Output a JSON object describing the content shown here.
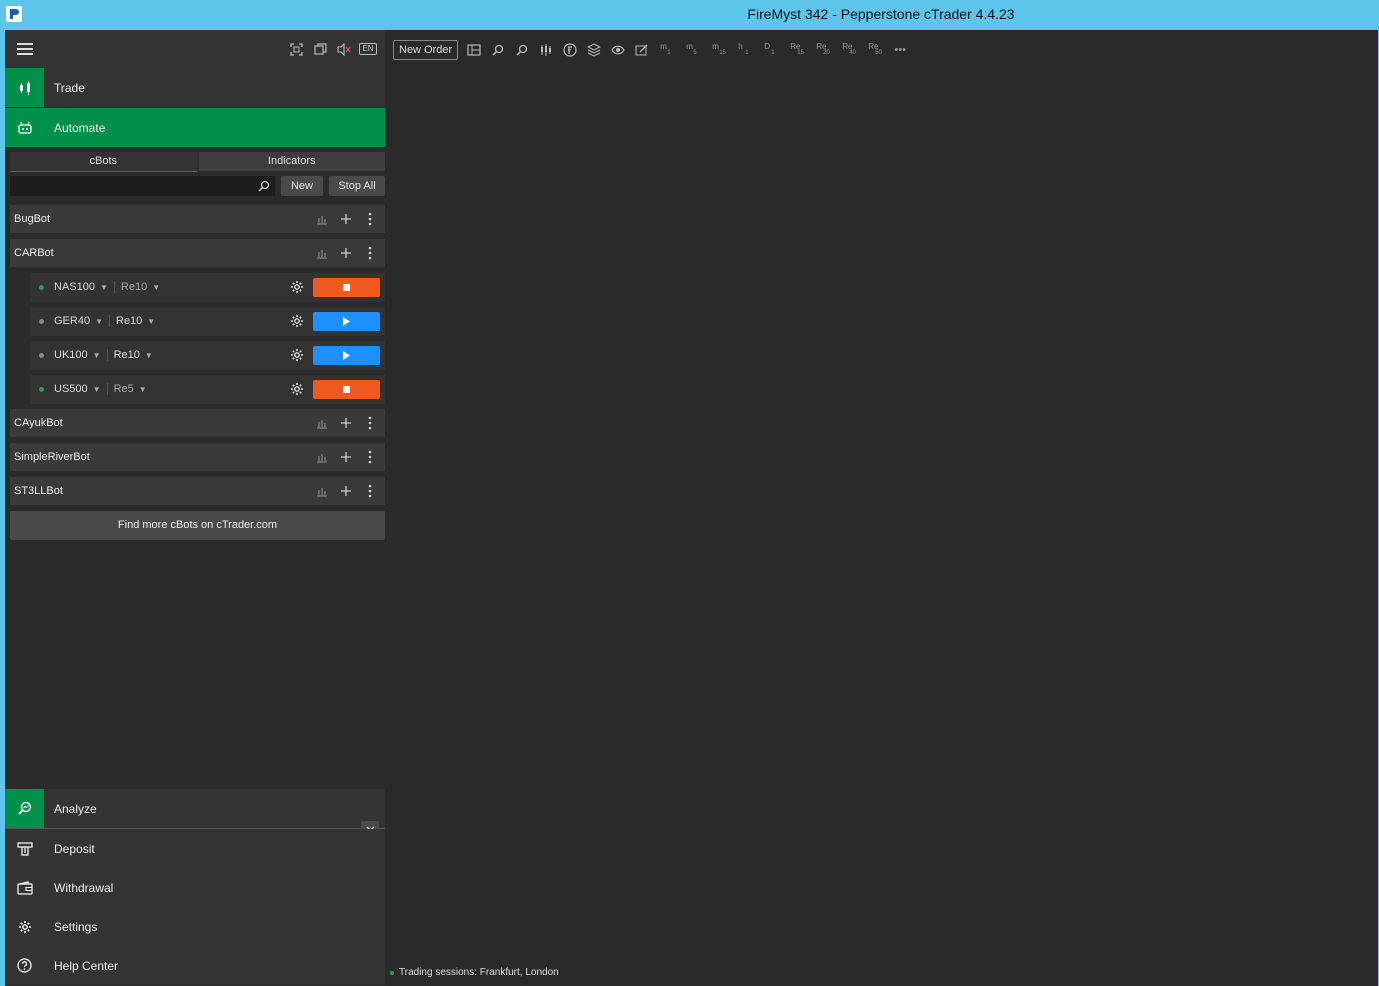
{
  "window": {
    "title": "FireMyst 342 - Pepperstone cTrader 4.4.23"
  },
  "sidebar": {
    "top_icons": [
      "fullscreen-icon",
      "windows-icon",
      "mute-icon"
    ],
    "lang": "EN",
    "nav": {
      "trade": "Trade",
      "automate": "Automate"
    },
    "tabs": {
      "cbots": "cBots",
      "indicators": "Indicators"
    },
    "search": {
      "value": "",
      "placeholder": ""
    },
    "buttons": {
      "new": "New",
      "stop_all": "Stop All"
    },
    "bots": [
      {
        "name": "BugBot"
      },
      {
        "name": "CARBot"
      },
      {
        "name": "CAyukBot"
      },
      {
        "name": "SimpleRiverBot"
      },
      {
        "name": "ST3LLBot"
      }
    ],
    "instances": [
      {
        "symbol": "NAS100",
        "timeframe": "Re10",
        "state": "running"
      },
      {
        "symbol": "GER40",
        "timeframe": "Re10",
        "state": "stopped"
      },
      {
        "symbol": "UK100",
        "timeframe": "Re10",
        "state": "stopped"
      },
      {
        "symbol": "US500",
        "timeframe": "Re5",
        "state": "running"
      }
    ],
    "find_more": "Find more cBots on cTrader.com",
    "bottom": {
      "analyze": "Analyze",
      "deposit": "Deposit",
      "withdrawal": "Withdrawal",
      "settings": "Settings",
      "help": "Help Center"
    }
  },
  "toolbar": {
    "new_order": "New Order",
    "timeframes": [
      {
        "t": "m",
        "s": "1"
      },
      {
        "t": "m",
        "s": "5"
      },
      {
        "t": "m",
        "s": "15"
      },
      {
        "t": "h",
        "s": "1"
      },
      {
        "t": "D",
        "s": "1"
      },
      {
        "t": "Re",
        "s": "15"
      },
      {
        "t": "Re",
        "s": "20"
      },
      {
        "t": "Re",
        "s": "40"
      },
      {
        "t": "Re",
        "s": "50"
      }
    ],
    "more": "•••"
  },
  "status": {
    "text": "Trading sessions: Frankfurt, London"
  },
  "colors": {
    "accent": "#00904a",
    "stop": "#f05a1e",
    "play": "#1e90ff",
    "titlebar": "#5ec5ea"
  }
}
